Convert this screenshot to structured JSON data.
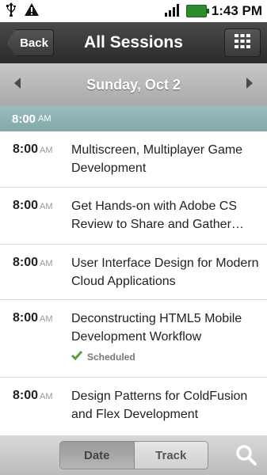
{
  "status_bar": {
    "time": "1:43 PM",
    "icons": [
      "usb-icon",
      "warning-icon",
      "signal-icon",
      "battery-icon"
    ]
  },
  "header": {
    "back_label": "Back",
    "title": "All Sessions",
    "grid_icon": "grid-icon"
  },
  "date_bar": {
    "date": "Sunday, Oct 2"
  },
  "time_header": {
    "time": "8:00",
    "ampm": "AM"
  },
  "sessions": [
    {
      "time": "8:00",
      "ampm": "AM",
      "title": "Multiscreen, Multiplayer Game Development",
      "status": ""
    },
    {
      "time": "8:00",
      "ampm": "AM",
      "title": "Get Hands-on with Adobe CS Review to Share and Gather…",
      "status": ""
    },
    {
      "time": "8:00",
      "ampm": "AM",
      "title": "User Interface Design for Modern Cloud Applications",
      "status": ""
    },
    {
      "time": "8:00",
      "ampm": "AM",
      "title": "Deconstructing HTML5 Mobile Development Workflow",
      "status": "Scheduled"
    },
    {
      "time": "8:00",
      "ampm": "AM",
      "title": "Design Patterns for ColdFusion and Flex Development",
      "status": ""
    }
  ],
  "bottom_bar": {
    "date_label": "Date",
    "track_label": "Track",
    "search_icon": "search-icon"
  },
  "colors": {
    "header_bg": "#333333",
    "date_bar_bg": "#b8b8b8",
    "time_bar_bg": "#8fb2b2",
    "check_green": "#5a9e3a"
  }
}
